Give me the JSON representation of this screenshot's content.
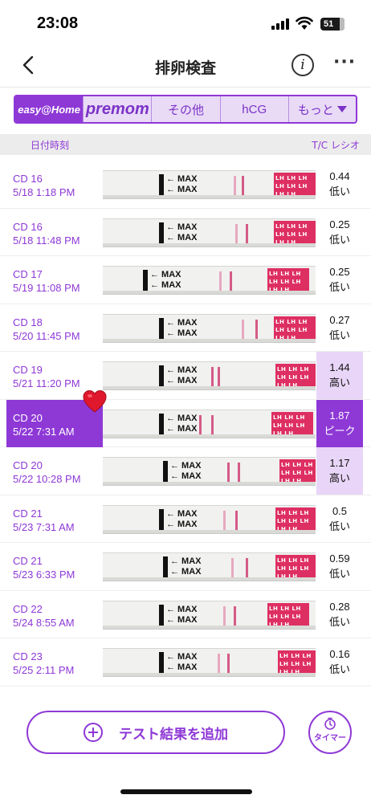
{
  "status_bar": {
    "time": "23:08",
    "battery": "51"
  },
  "nav": {
    "title": "排卵検査",
    "info_icon": "info-icon",
    "more_icon": "more-icon"
  },
  "brand_tabs": [
    {
      "label": "easy@Home",
      "active": true
    },
    {
      "label": "premom",
      "active": false
    },
    {
      "label": "その他",
      "active": false
    },
    {
      "label": "hCG",
      "active": false
    },
    {
      "label": "もっと",
      "active": false
    }
  ],
  "columns": {
    "left": "日付時刻",
    "right": "T/C レシオ"
  },
  "tests": [
    {
      "cd": "CD 16",
      "datetime": "5/18 1:18 PM",
      "ratio": "0.44",
      "level": "低い",
      "state": "low"
    },
    {
      "cd": "CD 16",
      "datetime": "5/18 11:48 PM",
      "ratio": "0.25",
      "level": "低い",
      "state": "low"
    },
    {
      "cd": "CD 17",
      "datetime": "5/19 11:08 PM",
      "ratio": "0.25",
      "level": "低い",
      "state": "low"
    },
    {
      "cd": "CD 18",
      "datetime": "5/20 11:45 PM",
      "ratio": "0.27",
      "level": "低い",
      "state": "low"
    },
    {
      "cd": "CD 19",
      "datetime": "5/21 11:20 PM",
      "ratio": "1.44",
      "level": "高い",
      "state": "high"
    },
    {
      "cd": "CD 20",
      "datetime": "5/22 7:31 AM",
      "ratio": "1.87",
      "level": "ピーク",
      "state": "peak"
    },
    {
      "cd": "CD 20",
      "datetime": "5/22 10:28 PM",
      "ratio": "1.17",
      "level": "高い",
      "state": "high"
    },
    {
      "cd": "CD 21",
      "datetime": "5/23 7:31 AM",
      "ratio": "0.5",
      "level": "低い",
      "state": "low"
    },
    {
      "cd": "CD 21",
      "datetime": "5/23 6:33 PM",
      "ratio": "0.59",
      "level": "低い",
      "state": "low"
    },
    {
      "cd": "CD 22",
      "datetime": "5/24 8:55 AM",
      "ratio": "0.28",
      "level": "低い",
      "state": "low"
    },
    {
      "cd": "CD 23",
      "datetime": "5/25 2:11 PM",
      "ratio": "0.16",
      "level": "低い",
      "state": "low"
    }
  ],
  "strip": {
    "max_label": "MAX",
    "lh_label": "LH"
  },
  "actions": {
    "add_label": "テスト結果を追加",
    "timer_label": "タイマー"
  },
  "colors": {
    "accent": "#8e38d6",
    "high_bg": "#e9d5f7",
    "lh_zone": "#de2f62"
  }
}
